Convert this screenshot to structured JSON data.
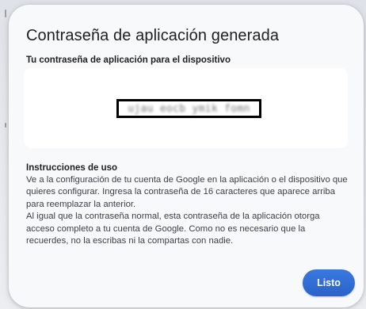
{
  "dialog": {
    "title": "Contraseña de aplicación generada",
    "password_label": "Tu contraseña de aplicación para el dispositivo",
    "password_value": "ujau eocb ymik fomn",
    "instructions_heading": "Instrucciones de uso",
    "instructions_paragraph_1": "Ve a la configuración de tu cuenta de Google en la aplicación o el dispositivo que quieres configurar. Ingresa la contraseña de 16 caracteres que aparece arriba para reemplazar la anterior.",
    "instructions_paragraph_2": "Al igual que la contraseña normal, esta contraseña de la aplicación otorga acceso completo a tu cuenta de Google. Como no es necesario que la recuerdes, no la escribas ni la compartas con nadie.",
    "done_label": "Listo"
  },
  "colors": {
    "accent": "#2f6ad0",
    "dialog_background": "#f8f9fb",
    "password_box_background": "#ffffff",
    "redaction_frame": "#000000"
  }
}
